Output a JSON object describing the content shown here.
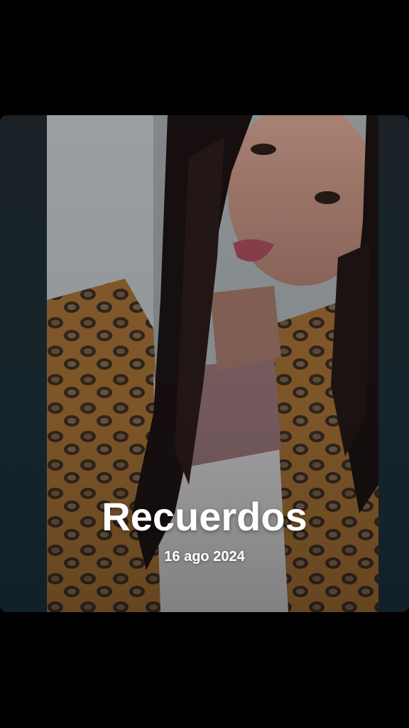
{
  "memory": {
    "title": "Recuerdos",
    "date": "16 ago 2024",
    "photo_icon": "portrait-photo"
  },
  "colors": {
    "background": "#000000",
    "card_background": "#16242b",
    "text": "#ffffff"
  }
}
